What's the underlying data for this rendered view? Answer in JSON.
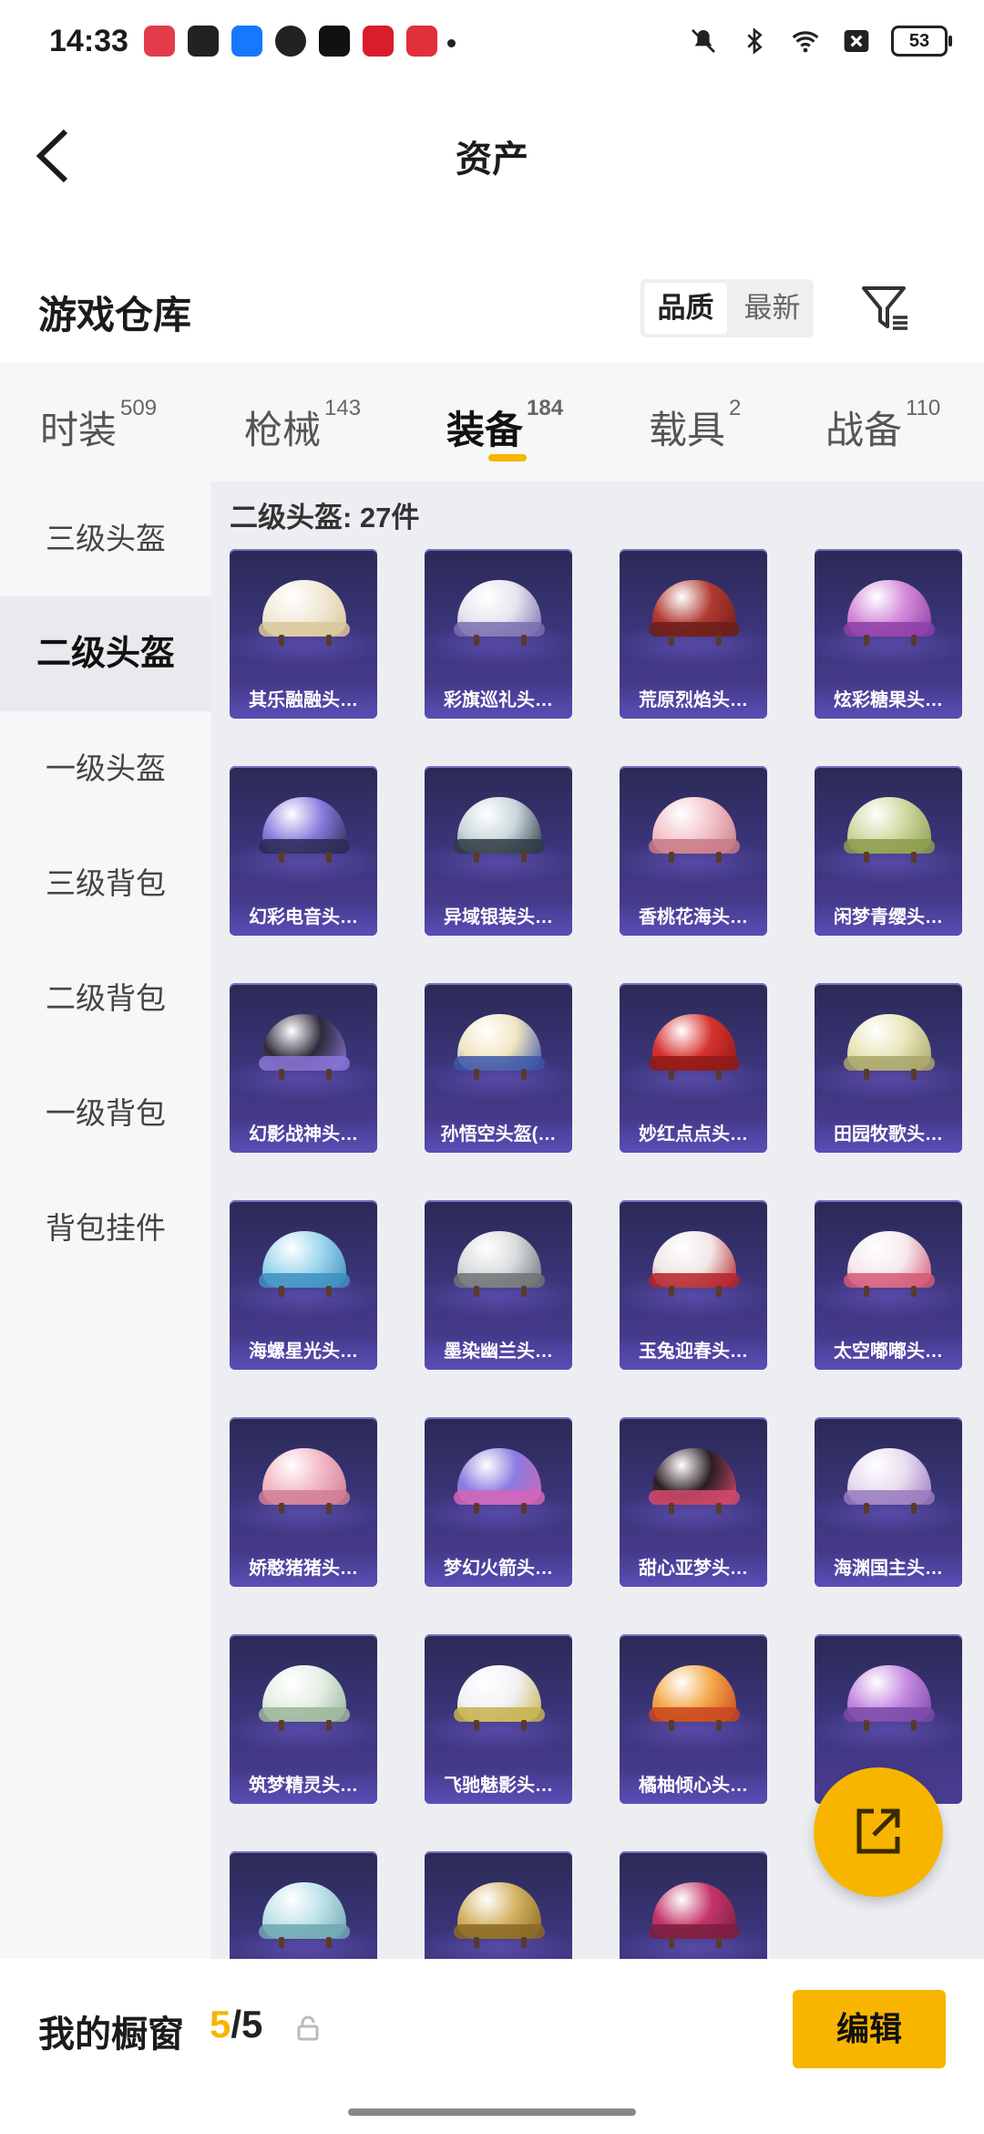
{
  "status_bar": {
    "time": "14:33",
    "battery": "53",
    "app_icons": [
      "music-icon",
      "shield-icon",
      "alipay-icon",
      "wechat-icon",
      "tiktok-icon",
      "red-app-icon",
      "red-bag-icon"
    ],
    "system_icons": [
      "mute-icon",
      "bluetooth-icon",
      "wifi-icon",
      "close-box-icon"
    ]
  },
  "header": {
    "title": "资产"
  },
  "warehouse": {
    "title": "游戏仓库",
    "sort_options": [
      "品质",
      "最新"
    ],
    "active_sort": "品质"
  },
  "tabs": [
    {
      "label": "时装",
      "count": "509"
    },
    {
      "label": "枪械",
      "count": "143"
    },
    {
      "label": "装备",
      "count": "184",
      "active": true
    },
    {
      "label": "载具",
      "count": "2"
    },
    {
      "label": "战备",
      "count": "110"
    }
  ],
  "sidebar": [
    {
      "label": "三级头盔"
    },
    {
      "label": "二级头盔",
      "active": true
    },
    {
      "label": "一级头盔"
    },
    {
      "label": "三级背包"
    },
    {
      "label": "二级背包"
    },
    {
      "label": "一级背包"
    },
    {
      "label": "背包挂件"
    }
  ],
  "grid": {
    "title": "二级头盔: 27件",
    "items": [
      {
        "name": "其乐融融头…",
        "dome": "#f2ead8",
        "rim": "#d9c79a"
      },
      {
        "name": "彩旗巡礼头…",
        "dome": "#e8e4f0",
        "rim": "#7a6fb0"
      },
      {
        "name": "荒原烈焰头…",
        "dome": "#b23a32",
        "rim": "#6b1f1a"
      },
      {
        "name": "炫彩糖果头…",
        "dome": "#d38ad9",
        "rim": "#8d3ea8"
      },
      {
        "name": "幻彩电音头…",
        "dome": "#8b7de0",
        "rim": "#2c2a55"
      },
      {
        "name": "异域银装头…",
        "dome": "#c9d6dc",
        "rim": "#2f3b45"
      },
      {
        "name": "香桃花海头…",
        "dome": "#f4c4cb",
        "rim": "#c77b86"
      },
      {
        "name": "闲梦青缨头…",
        "dome": "#cfd8a0",
        "rim": "#8c9c4e"
      },
      {
        "name": "幻影战神头…",
        "dome": "#2e2a3a",
        "rim": "#8a75d8"
      },
      {
        "name": "孙悟空头盔(…",
        "dome": "#f1e6c2",
        "rim": "#3b56a8"
      },
      {
        "name": "妙红点点头…",
        "dome": "#d6322f",
        "rim": "#8f1a18"
      },
      {
        "name": "田园牧歌头…",
        "dome": "#e8e6b8",
        "rim": "#a8a46a"
      },
      {
        "name": "海螺星光头…",
        "dome": "#9fd7ee",
        "rim": "#3e8fbf"
      },
      {
        "name": "墨染幽兰头…",
        "dome": "#d9dcdd",
        "rim": "#6e7477"
      },
      {
        "name": "玉兔迎春头…",
        "dome": "#f2e6e6",
        "rim": "#b5242a"
      },
      {
        "name": "太空嘟嘟头…",
        "dome": "#f6e9ee",
        "rim": "#d45a77"
      },
      {
        "name": "娇憨猪猪头…",
        "dome": "#f3b8c6",
        "rim": "#d07e95"
      },
      {
        "name": "梦幻火箭头…",
        "dome": "#8a7be0",
        "rim": "#d266b8"
      },
      {
        "name": "甜心亚梦头…",
        "dome": "#2b1d24",
        "rim": "#d34a6a"
      },
      {
        "name": "海渊国主头…",
        "dome": "#e7dcee",
        "rim": "#9a7abf"
      },
      {
        "name": "筑梦精灵头…",
        "dome": "#e6efe6",
        "rim": "#9bb59b"
      },
      {
        "name": "飞驰魅影头…",
        "dome": "#f2f2f6",
        "rim": "#c6b24e"
      },
      {
        "name": "橘柚倾心头…",
        "dome": "#f4a94a",
        "rim": "#c8461f"
      },
      {
        "name": "",
        "dome": "#c68be1",
        "rim": "#7a4aa8"
      },
      {
        "name": "",
        "dome": "#bfe3ea",
        "rim": "#6fa7b2"
      },
      {
        "name": "",
        "dome": "#d4b264",
        "rim": "#8a6a23"
      },
      {
        "name": "",
        "dome": "#c5356a",
        "rim": "#7b1f40"
      }
    ]
  },
  "bottom_bar": {
    "label": "我的橱窗",
    "count_current": "5",
    "count_total": "/5",
    "edit_label": "编辑"
  }
}
